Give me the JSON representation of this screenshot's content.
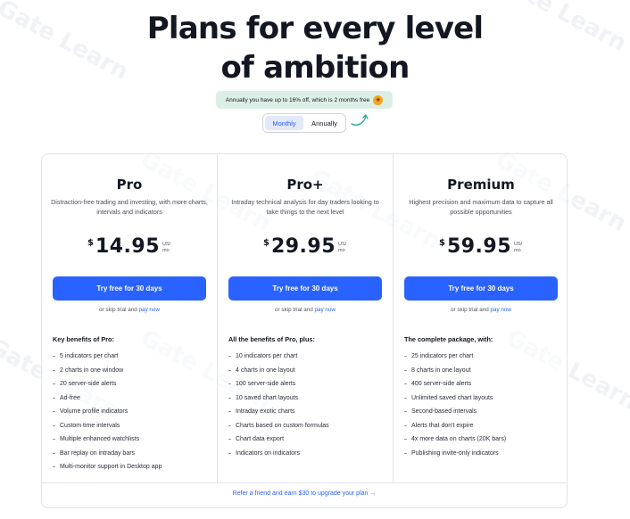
{
  "header": {
    "title_line1": "Plans for every level",
    "title_line2": "of ambition"
  },
  "promo": {
    "text": "Annually you have up to 16% off, which is 2 months free",
    "emoji_icon": "star-struck-emoji-icon"
  },
  "billing_toggle": {
    "options": [
      "Monthly",
      "Annually"
    ],
    "selected": "Monthly"
  },
  "watermark_text": "Gate Learn",
  "plans": [
    {
      "name": "Pro",
      "description": "Distraction-free trading and investing, with more charts, intervals and indicators",
      "currency": "$",
      "price": "14.95",
      "unit": "US/ mo",
      "cta": "Try free for 30 days",
      "skip_prefix": "or skip trial and",
      "skip_link": "pay now",
      "benefits_heading": "Key benefits of Pro:",
      "benefits": [
        "5 indicators per chart",
        "2 charts in one window",
        "20 server-side alerts",
        "Ad-free",
        "Volume profile indicators",
        "Custom time intervals",
        "Multiple enhanced watchlists",
        "Bar replay on intraday bars",
        "Multi-monitor support in Desktop app"
      ]
    },
    {
      "name": "Pro+",
      "description": "Intraday technical analysis for day traders looking to take things to the next level",
      "currency": "$",
      "price": "29.95",
      "unit": "US/ mo",
      "cta": "Try free for 30 days",
      "skip_prefix": "or skip trial and",
      "skip_link": "pay now",
      "benefits_heading": "All the benefits of Pro, plus:",
      "benefits": [
        "10 indicators per chart",
        "4 charts in one layout",
        "100 server-side alerts",
        "10 saved chart layouts",
        "Intraday exotic charts",
        "Charts based on custom formulas",
        "Chart data export",
        "Indicators on indicators"
      ]
    },
    {
      "name": "Premium",
      "description": "Highest precision and maximum data to capture all possible opportunities",
      "currency": "$",
      "price": "59.95",
      "unit": "US/ mo",
      "cta": "Try free for 30 days",
      "skip_prefix": "or skip trial and",
      "skip_link": "pay now",
      "benefits_heading": "The complete package, with:",
      "benefits": [
        "25 indicators per chart",
        "8 charts in one layout",
        "400 server-side alerts",
        "Unlimited saved chart layouts",
        "Second-based intervals",
        "Alerts that don't expire",
        "4x more data on charts (20K bars)",
        "Publishing invite-only indicators"
      ]
    }
  ],
  "referral": {
    "text": "Refer a friend and earn $30 to upgrade your plan →"
  },
  "colors": {
    "accent": "#2962ff",
    "promo_bg": "#dcefe7",
    "toggle_active_bg": "#e3e8fb"
  }
}
